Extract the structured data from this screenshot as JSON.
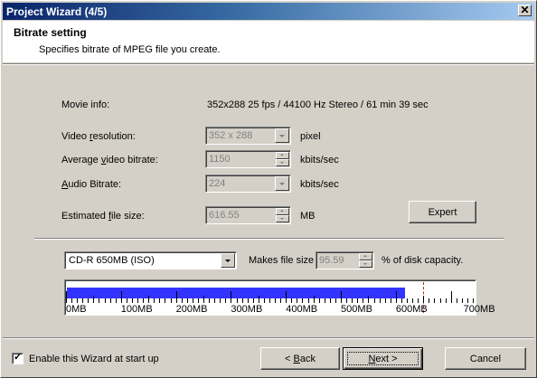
{
  "window": {
    "title": "Project Wizard (4/5)",
    "close_glyph": "✕"
  },
  "header": {
    "title": "Bitrate setting",
    "subtitle": "Specifies bitrate of MPEG file you create."
  },
  "movie_info": {
    "label": "Movie info:",
    "value": "352x288 25 fps / 44100 Hz Stereo / 61 min 39 sec"
  },
  "video_resolution": {
    "label_pre": "Video ",
    "label_u": "r",
    "label_post": "esolution:",
    "value": "352 x 288",
    "unit": "pixel"
  },
  "avg_video_bitrate": {
    "label_pre": "Average ",
    "label_u": "v",
    "label_post": "ideo bitrate:",
    "value": "1150",
    "unit": "kbits/sec"
  },
  "audio_bitrate": {
    "label_pre": "",
    "label_u": "A",
    "label_post": "udio Bitrate:",
    "value": "224",
    "unit": "kbits/sec"
  },
  "file_size": {
    "label_pre": "Estimated ",
    "label_u": "f",
    "label_post": "ile size:",
    "value": "616.55",
    "unit": "MB"
  },
  "expert_button": "Expert",
  "disk": {
    "selected": "CD-R 650MB (ISO)",
    "makes_label": "Makes file size",
    "percent_value": "95.59",
    "percent_suffix": "% of disk capacity."
  },
  "capacity_bar": {
    "fill_percent": 95.59,
    "used_mb": 616.55,
    "limit_mb": 650,
    "max_mb": 740,
    "ticks": [
      "0MB",
      "100MB",
      "200MB",
      "300MB",
      "400MB",
      "500MB",
      "600MB",
      "700MB"
    ],
    "fill_color": "#3333ff",
    "limit_color": "#d02020"
  },
  "footer": {
    "enable_wizard": {
      "label": "Enable this Wizard at start up",
      "checked": true,
      "check_glyph": "✓"
    },
    "back_pre": "< ",
    "back_u": "B",
    "back_post": "ack",
    "next_u": "N",
    "next_post": "ext >",
    "cancel": "Cancel"
  },
  "icons": {
    "dropdown": "chevron-down-icon",
    "spin": "spin-arrows-icon",
    "check": "checkmark-icon"
  }
}
